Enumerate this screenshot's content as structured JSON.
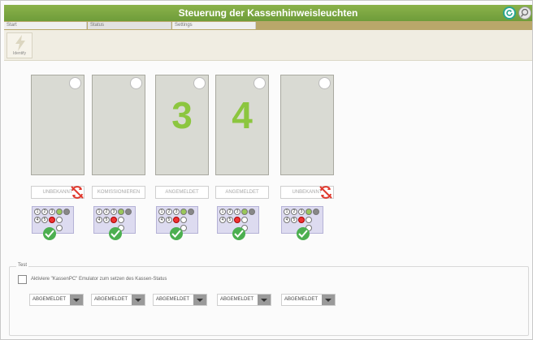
{
  "window": {
    "title": "Steuerung der Kassenhinweisleuchten"
  },
  "tabs": [
    {
      "label": "Start"
    },
    {
      "label": "Status"
    },
    {
      "label": "Settings"
    }
  ],
  "toolbar": {
    "identify_label": "Identify"
  },
  "registers": [
    {
      "number": "",
      "status": "UNBEKANNT",
      "alert": true
    },
    {
      "number": "",
      "status": "KOMISSIONIEREN",
      "alert": false
    },
    {
      "number": "3",
      "status": "ANGEMELDET",
      "alert": false
    },
    {
      "number": "4",
      "status": "ANGEMELDET",
      "alert": false
    },
    {
      "number": "",
      "status": "UNBEKANNT",
      "alert": true
    }
  ],
  "keypad": {
    "keys": [
      "1",
      "2",
      "3",
      "",
      "",
      "4",
      "5",
      "",
      "",
      ""
    ]
  },
  "test": {
    "legend": "Test",
    "emulator_label": "Aktiviere \"KassenPC\" Emulator zum setzen des Kassen-Status",
    "emulator_checked": false,
    "selects": [
      {
        "value": "ABGEMELDET"
      },
      {
        "value": "ABGEMELDET"
      },
      {
        "value": "ABGEMELDET"
      },
      {
        "value": "ABGEMELDET"
      },
      {
        "value": "ABGEMELDET"
      }
    ]
  },
  "colors": {
    "titlebar": "#7aa63f",
    "accent_green": "#8cc63f",
    "alert_red": "#e03a2f",
    "check_green": "#4caf50"
  }
}
